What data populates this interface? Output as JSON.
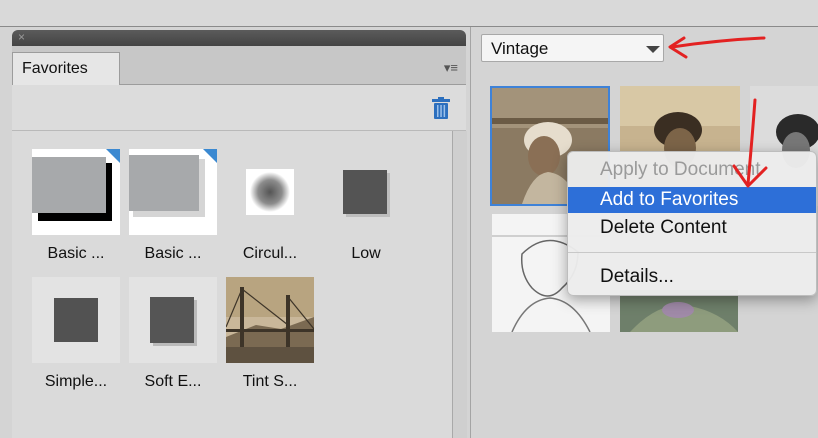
{
  "panel": {
    "close_glyph": "×",
    "tab_label": "Favorites",
    "menu_glyph": "▾≡",
    "items": [
      {
        "label": "Basic ...",
        "icon": "drop-shadow-preset-icon"
      },
      {
        "label": "Basic ...",
        "icon": "outer-shadow-preset-icon"
      },
      {
        "label": "Circul...",
        "icon": "circular-vignette-icon"
      },
      {
        "label": "Low",
        "icon": "low-shadow-square-icon"
      },
      {
        "label": "Simple...",
        "icon": "simple-square-icon"
      },
      {
        "label": "Soft E...",
        "icon": "soft-edge-square-icon"
      },
      {
        "label": "Tint S...",
        "icon": "tint-sepia-photo"
      }
    ]
  },
  "content": {
    "category_value": "Vintage"
  },
  "context_menu": {
    "items": [
      {
        "label": "Apply to Document",
        "state": "disabled"
      },
      {
        "label": "Add to Favorites",
        "state": "highlighted"
      },
      {
        "label": "Delete Content",
        "state": "normal"
      },
      {
        "label": "Details...",
        "state": "normal"
      }
    ]
  },
  "colors": {
    "selection_blue": "#3e82d8",
    "menu_highlight": "#2d6fd8",
    "annotation_red": "#e32222",
    "trash_blue": "#2c6fbe"
  }
}
